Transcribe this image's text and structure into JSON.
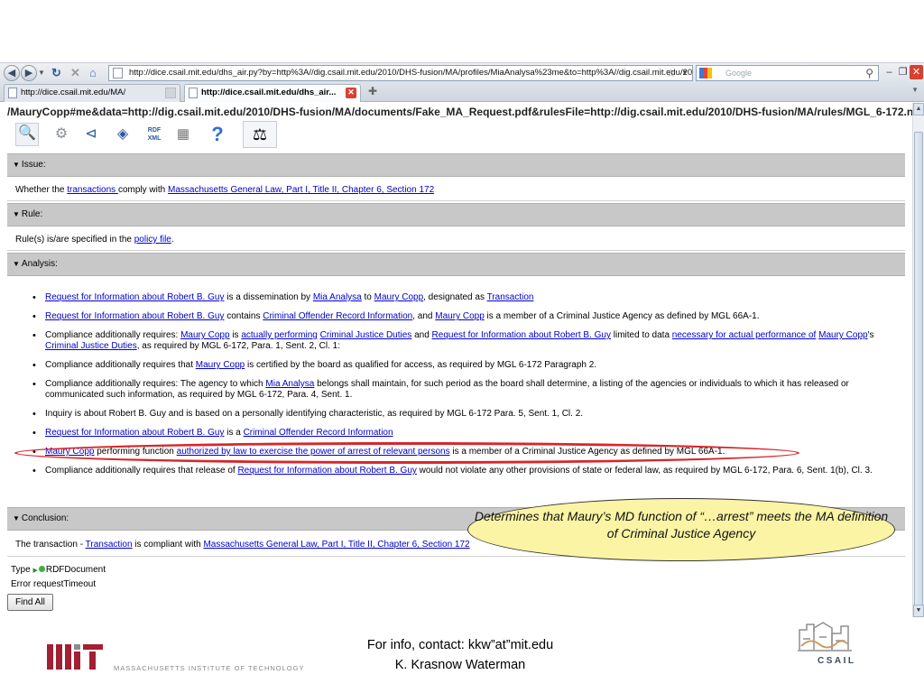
{
  "browser": {
    "address_url": "http://dice.csail.mit.edu/dhs_air.py?by=http%3A//dig.csail.mit.edu/2010/DHS-fusion/MA/profiles/MiaAnalysa%23me&to=http%3A//dig.csail.mit.edu/20",
    "search_placeholder": "Google",
    "tabs": [
      {
        "label": "http://dice.csail.mit.edu/MA/"
      },
      {
        "label": "http://dice.csail.mit.edu/dhs_air..."
      }
    ],
    "icons": {
      "back": "left-arrow-icon",
      "forward": "right-arrow-icon",
      "reload": "reload-icon",
      "stop": "stop-icon",
      "home": "home-icon",
      "bookmark": "star-icon",
      "search": "magnifier-icon",
      "minimize": "minimize-icon",
      "restore": "restore-icon",
      "close": "close-icon"
    }
  },
  "page": {
    "url_line": "/MauryCopp#me&data=http://dig.csail.mit.edu/2010/DHS-fusion/MA/documents/Fake_MA_Request.pdf&rulesFile=http://dig.csail.mit.edu/2010/DHS-fusion/MA/rules/MGL_6-172.n3",
    "toolbar_icons": [
      "lens-icon",
      "gear-icon",
      "share-icon",
      "graph-icon",
      "rdf-xml-icon",
      "table-icon",
      "help-icon",
      "scales-icon"
    ],
    "issue": {
      "header": "Issue:",
      "text_1": "Whether the ",
      "link_1": "transactions ",
      "text_2": "comply with ",
      "link_2": "Massachusetts General Law, Part I, Title II, Chapter 6, Section 172"
    },
    "rule": {
      "header": "Rule:",
      "text_1": "Rule(s) is/are specified in the ",
      "link_1": "policy file",
      "text_2": "."
    },
    "analysis": {
      "header": "Analysis:",
      "items": [
        {
          "a": "Request for Information about Robert B. Guy",
          "b": " is a dissemination by ",
          "c": "Mia Analysa",
          "d": " to ",
          "e": "Maury Copp",
          "f": ", designated as ",
          "g": "Transaction"
        },
        {
          "a": "Request for Information about Robert B. Guy",
          "b": " contains ",
          "c": "Criminal Offender Record Information",
          "d": ", and ",
          "e": "Maury Copp",
          "f": " is a member of a Criminal Justice Agency as defined by MGL 66A-1."
        },
        {
          "a": "Compliance additionally requires: ",
          "b": "Maury Copp",
          "c": " is ",
          "d": "actually performing",
          "e": " ",
          "f": "Criminal Justice Duties",
          "g": " and ",
          "h": "Request for Information about Robert B. Guy",
          "i": " limited to data ",
          "j": "necessary for actual performance of",
          "k": " ",
          "l": "Maury Copp",
          "m": "'s ",
          "n": "Criminal Justice Duties",
          "o": ", as required by MGL 6-172, Para. 1, Sent. 2, Cl. 1:"
        },
        {
          "a": "Compliance additionally requires that ",
          "b": "Maury Copp",
          "c": " is certified by the board as qualified for access, as required by MGL 6-172 Paragraph 2."
        },
        {
          "a": "Compliance additionally requires: The agency to which ",
          "b": "Mia Analysa",
          "c": " belongs shall maintain, for such period as the board shall determine, a listing of the agencies or individuals to which it has released or communicated such information, as required by MGL 6-172, Para. 4, Sent. 1."
        },
        {
          "a": "Inquiry is about Robert B. Guy and is based on a personally identifying characteristic, as required by MGL 6-172 Para. 5, Sent. 1, Cl. 2."
        },
        {
          "a": "Request for Information about Robert B. Guy",
          "b": " is a ",
          "c": "Criminal Offender Record Information"
        },
        {
          "a": "Maury Copp",
          "b": " performing function ",
          "c": "authorized by law to exercise the power of arrest of relevant persons",
          "d": " is a member of a Criminal Justice Agency as defined by MGL 66A-1."
        },
        {
          "a": "Compliance additionally requires that release of ",
          "b": "Request for Information about Robert B. Guy",
          "c": " would not violate any other provisions of state or federal law, as required by MGL 6-172, Para. 6, Sent. 1(b), Cl. 3."
        }
      ]
    },
    "conclusion": {
      "header": "Conclusion:",
      "text_1": "The transaction - ",
      "link_1": "Transaction",
      "text_2": " is compliant with ",
      "link_2": "Massachusetts General Law, Part I, Title II, Chapter 6, Section 172"
    },
    "type_label": "Type",
    "type_value": "RDFDocument",
    "error_label": "Error",
    "error_value": "requestTimeout",
    "find_all_label": "Find All"
  },
  "callout": {
    "text": "Determines that Maury’s MD function of “…arrest” meets the MA definition of Criminal Justice Agency"
  },
  "footer": {
    "contact": "For info, contact: kkw”at”mit.edu",
    "author": "K. Krasnow Waterman",
    "mit_name": "MASSACHUSETTS INSTITUTE OF TECHNOLOGY",
    "csail_name": "CSAIL"
  },
  "colors": {
    "section_bar": "#c8c8c8",
    "link": "#0000cc",
    "highlight_oval": "#d9262a",
    "callout_fill": "#fbf4a4",
    "mit_red": "#a31f34"
  }
}
